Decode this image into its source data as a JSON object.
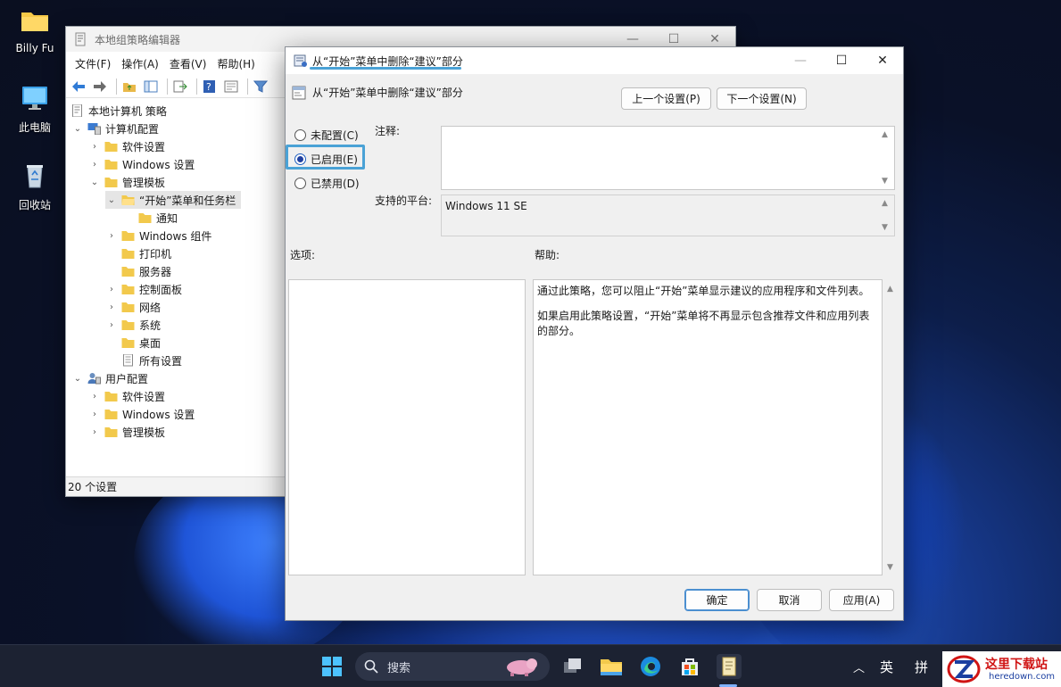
{
  "desktop": {
    "icons": [
      {
        "label": "Billy Fu"
      },
      {
        "label": "此电脑"
      },
      {
        "label": "回收站"
      }
    ]
  },
  "editor": {
    "title": "本地组策略编辑器",
    "menu": [
      "文件(F)",
      "操作(A)",
      "查看(V)",
      "帮助(H)"
    ],
    "tree": [
      {
        "label": "本地计算机 策略"
      },
      {
        "label": "计算机配置"
      },
      {
        "label": "软件设置"
      },
      {
        "label": "Windows 设置"
      },
      {
        "label": "管理模板"
      },
      {
        "label": "“开始”菜单和任务栏"
      },
      {
        "label": "通知"
      },
      {
        "label": "Windows 组件"
      },
      {
        "label": "打印机"
      },
      {
        "label": "服务器"
      },
      {
        "label": "控制面板"
      },
      {
        "label": "网络"
      },
      {
        "label": "系统"
      },
      {
        "label": "桌面"
      },
      {
        "label": "所有设置"
      },
      {
        "label": "用户配置"
      },
      {
        "label": "软件设置"
      },
      {
        "label": "Windows 设置"
      },
      {
        "label": "管理模板"
      }
    ],
    "status": "20 个设置"
  },
  "dialog": {
    "title": "从“开始”菜单中删除“建议”部分",
    "policy_name": "从“开始”菜单中删除“建议”部分",
    "prev_button": "上一个设置(P)",
    "next_button": "下一个设置(N)",
    "options": [
      {
        "label": "未配置(C)",
        "checked": false
      },
      {
        "label": "已启用(E)",
        "checked": true
      },
      {
        "label": "已禁用(D)",
        "checked": false
      }
    ],
    "comment_label": "注释:",
    "comment_value": "",
    "platform_label": "支持的平台:",
    "platform_value": "Windows 11 SE",
    "options_label": "选项:",
    "help_label": "帮助:",
    "help_paragraphs": [
      "通过此策略，您可以阻止“开始”菜单显示建议的应用程序和文件列表。",
      "如果启用此策略设置，“开始”菜单将不再显示包含推荐文件和应用列表的部分。"
    ],
    "ok_button": "确定",
    "cancel_button": "取消",
    "apply_button": "应用(A)"
  },
  "taskbar": {
    "search_placeholder": "搜索",
    "ime_lang": "英",
    "ime_mode": "拼"
  },
  "watermark": {
    "title": "这里下载站",
    "url": "heredown.com"
  },
  "colors": {
    "accent": "#4aa2d6",
    "folder": "#f2c94c",
    "taskbar": "#1c2232"
  }
}
